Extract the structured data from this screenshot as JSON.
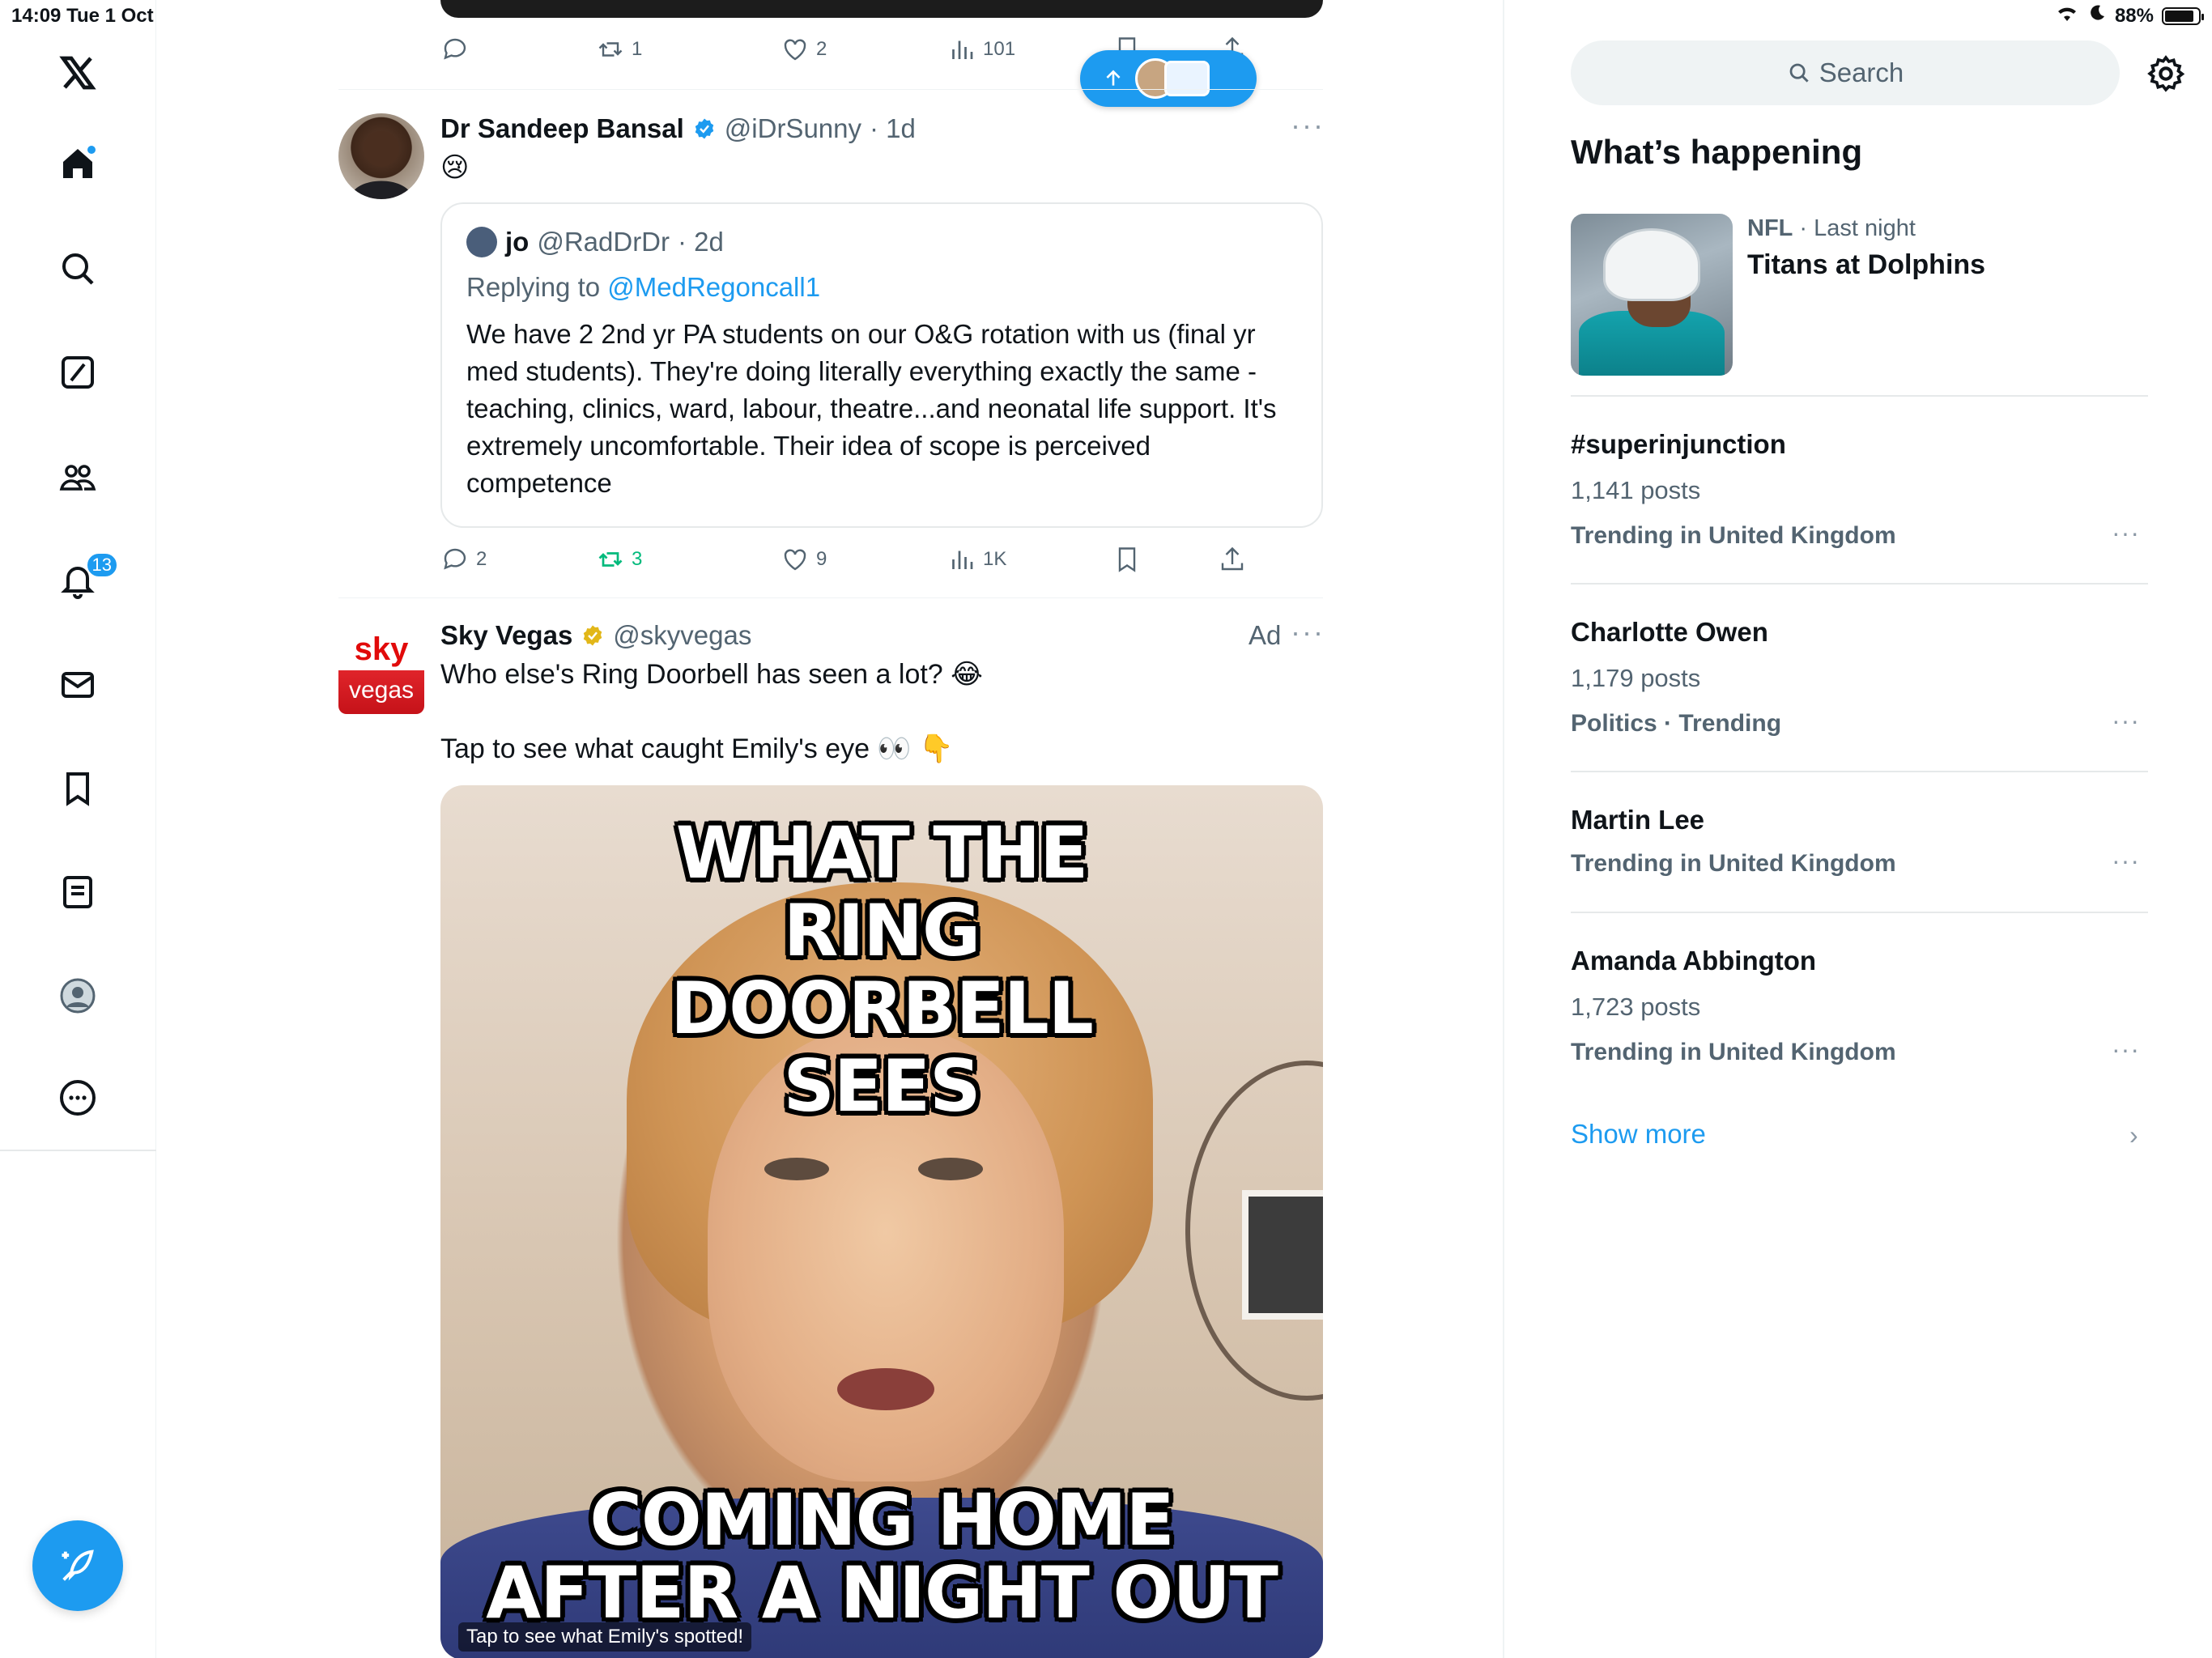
{
  "status_bar": {
    "time": "14:09",
    "date": "Tue 1 Oct",
    "battery": "88%",
    "battery_level": 0.88
  },
  "nav": {
    "items": [
      "x-logo",
      "home",
      "search",
      "grok",
      "communities",
      "notifications",
      "messages",
      "bookmarks",
      "lists",
      "profile",
      "more"
    ],
    "notifications_count": "13"
  },
  "prev_tweet_actions": {
    "retweets": "1",
    "likes": "2",
    "views": "101"
  },
  "tweet1": {
    "name": "Dr Sandeep Bansal",
    "handle": "@iDrSunny",
    "time": "· 1d",
    "text": "😢",
    "quote": {
      "name": "jo",
      "handle": "@RadDrDr",
      "time": "· 2d",
      "replying_prefix": "Replying to ",
      "replying_to": "@MedRegoncall1",
      "text": "We have 2 2nd yr PA students on our O&G rotation with us (final yr med students). They're doing literally everything exactly the same - teaching, clinics, ward, labour, theatre...and neonatal life support. It's extremely uncomfortable. Their idea of scope is perceived competence"
    },
    "actions": {
      "replies": "2",
      "retweets": "3",
      "likes": "9",
      "views": "1K"
    }
  },
  "tweet2": {
    "name": "Sky Vegas",
    "handle": "@skyvegas",
    "ad_label": "Ad",
    "logo_top": "sky",
    "logo_bottom": "vegas",
    "text_line1": "Who else's Ring Doorbell has seen a lot? 😂",
    "text_line2": "Tap to see what caught Emily's eye  👀 👇",
    "media_top_text": "WHAT THE RING DOORBELL SEES",
    "media_bottom_line1": "COMING HOME",
    "media_bottom_line2": "AFTER A NIGHT OUT",
    "media_caption": "Tap to see what Emily's spotted!"
  },
  "sidebar": {
    "search_placeholder": "Search",
    "title": "What’s happening",
    "nfl": {
      "category": "NFL",
      "time": " · Last night",
      "title": "Titans at Dolphins"
    },
    "trends": [
      {
        "name": "#superinjunction",
        "posts": "1,141 posts",
        "context": "Trending in United Kingdom"
      },
      {
        "name": "Charlotte Owen",
        "posts": "1,179 posts",
        "context": "Politics · Trending"
      },
      {
        "name": "Martin Lee",
        "posts": "",
        "context": "Trending in United Kingdom"
      },
      {
        "name": "Amanda Abbington",
        "posts": "1,723 posts",
        "context": "Trending in United Kingdom"
      }
    ],
    "show_more": "Show more"
  },
  "colors": {
    "accent": "#1d9bf0",
    "retweet_green": "#00ba7c",
    "muted": "#536471"
  }
}
